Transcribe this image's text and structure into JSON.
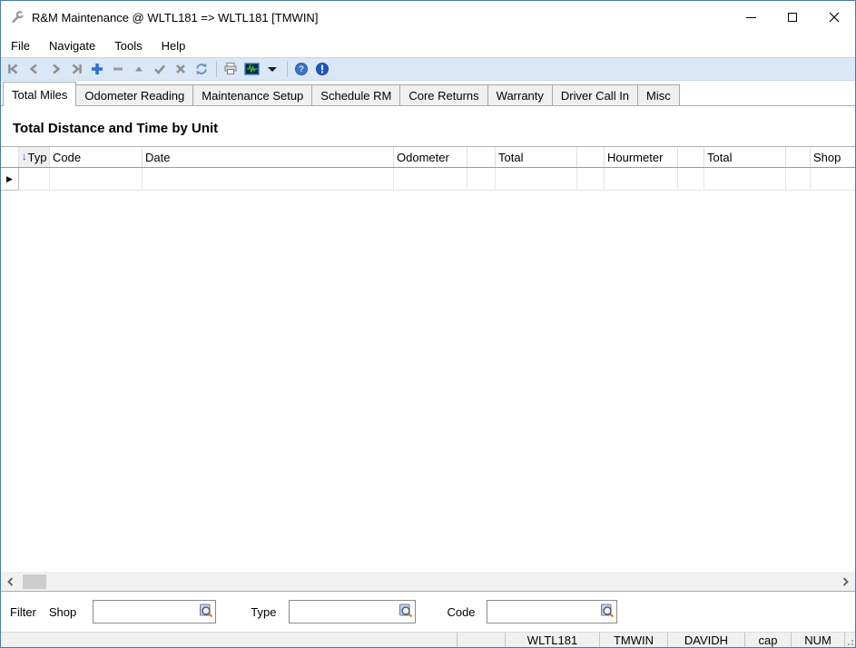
{
  "window": {
    "title": "R&M Maintenance @ WLTL181 => WLTL181 [TMWIN]"
  },
  "menu": {
    "items": [
      {
        "label": "File"
      },
      {
        "label": "Navigate"
      },
      {
        "label": "Tools"
      },
      {
        "label": "Help"
      }
    ]
  },
  "toolbar": {
    "buttons": [
      "first-record",
      "previous-record",
      "next-record",
      "last-record",
      "add-record",
      "delete-record",
      "collapse",
      "post-edit",
      "cancel-edit",
      "refresh",
      "print",
      "activity-monitor",
      "print-dropdown",
      "help",
      "about"
    ]
  },
  "tabs": {
    "items": [
      {
        "label": "Total Miles",
        "active": true
      },
      {
        "label": "Odometer Reading",
        "active": false
      },
      {
        "label": "Maintenance Setup",
        "active": false
      },
      {
        "label": "Schedule RM",
        "active": false
      },
      {
        "label": "Core Returns",
        "active": false
      },
      {
        "label": "Warranty",
        "active": false
      },
      {
        "label": "Driver Call In",
        "active": false
      },
      {
        "label": "Misc",
        "active": false
      }
    ]
  },
  "page": {
    "section_title": "Total Distance and Time by Unit"
  },
  "grid": {
    "sort_arrow": "↓",
    "record_indicator": "▶",
    "columns": [
      {
        "label": ""
      },
      {
        "label": "Typ",
        "sorted": true
      },
      {
        "label": "Code"
      },
      {
        "label": "Date"
      },
      {
        "label": "Odometer"
      },
      {
        "label": ""
      },
      {
        "label": "Total"
      },
      {
        "label": ""
      },
      {
        "label": "Hourmeter"
      },
      {
        "label": ""
      },
      {
        "label": "Total"
      },
      {
        "label": ""
      },
      {
        "label": "Shop"
      }
    ],
    "rows": []
  },
  "filter": {
    "label": "Filter",
    "fields": [
      {
        "label": "Shop",
        "value": ""
      },
      {
        "label": "Type",
        "value": ""
      },
      {
        "label": "Code",
        "value": ""
      }
    ]
  },
  "status": {
    "segments": [
      {
        "label": ""
      },
      {
        "label": ""
      },
      {
        "label": "WLTL181"
      },
      {
        "label": "TMWIN"
      },
      {
        "label": "DAVIDH"
      },
      {
        "label": "cap"
      },
      {
        "label": "NUM"
      }
    ]
  },
  "colors": {
    "window_border": "#4a7ab0",
    "toolbar_bg": "#d9e7f6",
    "accent_blue": "#2e6fd4",
    "sort_arrow_blue": "#2b3cc4",
    "status_bg": "#f0f0f0",
    "monitor_green": "#33cc33"
  }
}
